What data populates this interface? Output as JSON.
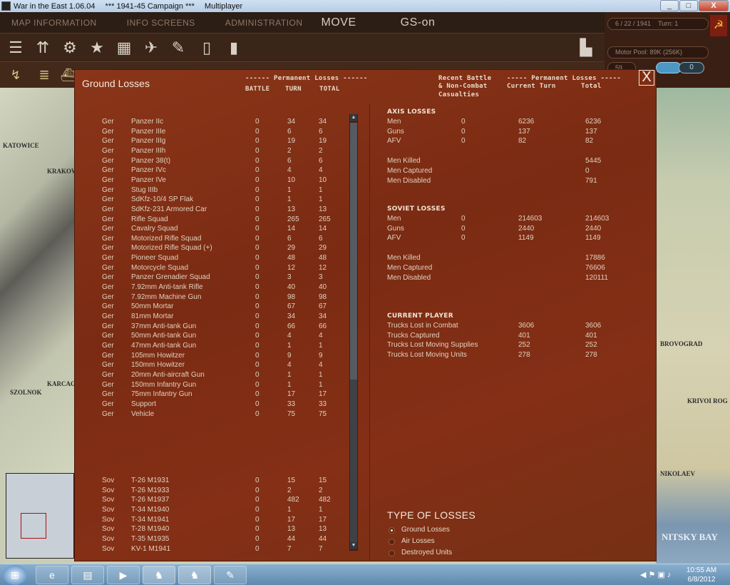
{
  "window": {
    "title": "War in the East 1.06.04",
    "campaign": "***    1941-45 Campaign    ***",
    "mode": "Multiplayer",
    "min_label": "_",
    "max_label": "□",
    "close_label": "X"
  },
  "menu": {
    "map_information": "MAP INFORMATION",
    "info_screens": "INFO SCREENS",
    "administration": "ADMINISTRATION",
    "move": "MOVE",
    "gs_on": "GS-on"
  },
  "status": {
    "date": "6 / 22 / 1941",
    "turn": "Turn: 1",
    "motor_pool": "Motor Pool: 89K (256K)",
    "value_box": "59",
    "pill_1": "",
    "pill_2": "0"
  },
  "map_labels": {
    "katowice": "KATOWICE",
    "krakow": "KRAKOW",
    "szolnok": "SZOLNOK",
    "karcag": "KARCAG",
    "krivoi_rog": "KRIVOI ROG",
    "nikolaev": "NIKOLAEV",
    "bovograd": "BROVOGRAD",
    "nitsky_bay": "NITSKY BAY"
  },
  "dialog": {
    "title": "Ground Losses",
    "left_group_header": "------ Permanent Losses ------",
    "col_battle": "BATTLE",
    "col_turn": "TURN",
    "col_total": "TOTAL",
    "recent_header_1": "Recent Battle",
    "recent_header_2": "& Non-Combat",
    "recent_header_3": "Casualties",
    "right_group_header": "----- Permanent Losses -----",
    "col_current_turn": "Current Turn",
    "col_total_right": "Total",
    "close_icon": "X"
  },
  "ger_rows": [
    {
      "side": "Ger",
      "unit": "Panzer IIc",
      "battle": "0",
      "turn": "34",
      "total": "34"
    },
    {
      "side": "Ger",
      "unit": "Panzer IIIe",
      "battle": "0",
      "turn": "6",
      "total": "6"
    },
    {
      "side": "Ger",
      "unit": "Panzer IIIg",
      "battle": "0",
      "turn": "19",
      "total": "19"
    },
    {
      "side": "Ger",
      "unit": "Panzer IIIh",
      "battle": "0",
      "turn": "2",
      "total": "2"
    },
    {
      "side": "Ger",
      "unit": "Panzer 38(t)",
      "battle": "0",
      "turn": "6",
      "total": "6"
    },
    {
      "side": "Ger",
      "unit": "Panzer IVc",
      "battle": "0",
      "turn": "4",
      "total": "4"
    },
    {
      "side": "Ger",
      "unit": "Panzer IVe",
      "battle": "0",
      "turn": "10",
      "total": "10"
    },
    {
      "side": "Ger",
      "unit": "Stug IIIb",
      "battle": "0",
      "turn": "1",
      "total": "1"
    },
    {
      "side": "Ger",
      "unit": "SdKfz-10/4 SP Flak",
      "battle": "0",
      "turn": "1",
      "total": "1"
    },
    {
      "side": "Ger",
      "unit": "SdKfz-231 Armored Car",
      "battle": "0",
      "turn": "13",
      "total": "13"
    },
    {
      "side": "Ger",
      "unit": "Rifle Squad",
      "battle": "0",
      "turn": "265",
      "total": "265"
    },
    {
      "side": "Ger",
      "unit": "Cavalry Squad",
      "battle": "0",
      "turn": "14",
      "total": "14"
    },
    {
      "side": "Ger",
      "unit": "Motorized Rifle Squad",
      "battle": "0",
      "turn": "6",
      "total": "6"
    },
    {
      "side": "Ger",
      "unit": "Motorized Rifle Squad (+)",
      "battle": "0",
      "turn": "29",
      "total": "29"
    },
    {
      "side": "Ger",
      "unit": "Pioneer Squad",
      "battle": "0",
      "turn": "48",
      "total": "48"
    },
    {
      "side": "Ger",
      "unit": "Motorcycle Squad",
      "battle": "0",
      "turn": "12",
      "total": "12"
    },
    {
      "side": "Ger",
      "unit": "Panzer Grenadier Squad",
      "battle": "0",
      "turn": "3",
      "total": "3"
    },
    {
      "side": "Ger",
      "unit": "7.92mm Anti-tank Rifle",
      "battle": "0",
      "turn": "40",
      "total": "40"
    },
    {
      "side": "Ger",
      "unit": "7.92mm Machine Gun",
      "battle": "0",
      "turn": "98",
      "total": "98"
    },
    {
      "side": "Ger",
      "unit": "50mm Mortar",
      "battle": "0",
      "turn": "67",
      "total": "67"
    },
    {
      "side": "Ger",
      "unit": "81mm Mortar",
      "battle": "0",
      "turn": "34",
      "total": "34"
    },
    {
      "side": "Ger",
      "unit": "37mm Anti-tank Gun",
      "battle": "0",
      "turn": "66",
      "total": "66"
    },
    {
      "side": "Ger",
      "unit": "50mm Anti-tank Gun",
      "battle": "0",
      "turn": "4",
      "total": "4"
    },
    {
      "side": "Ger",
      "unit": "47mm Anti-tank Gun",
      "battle": "0",
      "turn": "1",
      "total": "1"
    },
    {
      "side": "Ger",
      "unit": "105mm Howitzer",
      "battle": "0",
      "turn": "9",
      "total": "9"
    },
    {
      "side": "Ger",
      "unit": "150mm Howitzer",
      "battle": "0",
      "turn": "4",
      "total": "4"
    },
    {
      "side": "Ger",
      "unit": "20mm Anti-aircraft Gun",
      "battle": "0",
      "turn": "1",
      "total": "1"
    },
    {
      "side": "Ger",
      "unit": "150mm Infantry Gun",
      "battle": "0",
      "turn": "1",
      "total": "1"
    },
    {
      "side": "Ger",
      "unit": "75mm Infantry Gun",
      "battle": "0",
      "turn": "17",
      "total": "17"
    },
    {
      "side": "Ger",
      "unit": "Support",
      "battle": "0",
      "turn": "33",
      "total": "33"
    },
    {
      "side": "Ger",
      "unit": "Vehicle",
      "battle": "0",
      "turn": "75",
      "total": "75"
    }
  ],
  "sov_rows": [
    {
      "side": "Sov",
      "unit": "T-26 M1931",
      "battle": "0",
      "turn": "15",
      "total": "15"
    },
    {
      "side": "Sov",
      "unit": "T-26 M1933",
      "battle": "0",
      "turn": "2",
      "total": "2"
    },
    {
      "side": "Sov",
      "unit": "T-26 M1937",
      "battle": "0",
      "turn": "482",
      "total": "482"
    },
    {
      "side": "Sov",
      "unit": "T-34 M1940",
      "battle": "0",
      "turn": "1",
      "total": "1"
    },
    {
      "side": "Sov",
      "unit": "T-34 M1941",
      "battle": "0",
      "turn": "17",
      "total": "17"
    },
    {
      "side": "Sov",
      "unit": "T-28 M1940",
      "battle": "0",
      "turn": "13",
      "total": "13"
    },
    {
      "side": "Sov",
      "unit": "T-35 M1935",
      "battle": "0",
      "turn": "44",
      "total": "44"
    },
    {
      "side": "Sov",
      "unit": "KV-1 M1941",
      "battle": "0",
      "turn": "7",
      "total": "7"
    }
  ],
  "axis": {
    "heading": "AXIS LOSSES",
    "rows": [
      {
        "label": "Men",
        "recent": "0",
        "turn": "6236",
        "total": "6236"
      },
      {
        "label": "Guns",
        "recent": "0",
        "turn": "137",
        "total": "137"
      },
      {
        "label": "AFV",
        "recent": "0",
        "turn": "82",
        "total": "82"
      }
    ],
    "killed": {
      "label": "Men Killed",
      "total": "5445"
    },
    "captured": {
      "label": "Men Captured",
      "total": "0"
    },
    "disabled": {
      "label": "Men Disabled",
      "total": "791"
    }
  },
  "soviet": {
    "heading": "SOVIET LOSSES",
    "rows": [
      {
        "label": "Men",
        "recent": "0",
        "turn": "214603",
        "total": "214603"
      },
      {
        "label": "Guns",
        "recent": "0",
        "turn": "2440",
        "total": "2440"
      },
      {
        "label": "AFV",
        "recent": "0",
        "turn": "1149",
        "total": "1149"
      }
    ],
    "killed": {
      "label": "Men Killed",
      "total": "17886"
    },
    "captured": {
      "label": "Men Captured",
      "total": "76606"
    },
    "disabled": {
      "label": "Men Disabled",
      "total": "120111"
    }
  },
  "current_player": {
    "heading": "CURRENT PLAYER",
    "rows": [
      {
        "label": "Trucks Lost in Combat",
        "turn": "3606",
        "total": "3606"
      },
      {
        "label": "Trucks Captured",
        "turn": "401",
        "total": "401"
      },
      {
        "label": "Trucks Lost Moving Supplies",
        "turn": "252",
        "total": "252"
      },
      {
        "label": "Trucks Lost Moving Units",
        "turn": "278",
        "total": "278"
      }
    ]
  },
  "type_of_losses": {
    "heading": "TYPE OF LOSSES",
    "options": [
      {
        "label": "Ground Losses",
        "selected": true
      },
      {
        "label": "Air Losses",
        "selected": false
      },
      {
        "label": "Destroyed Units",
        "selected": false
      }
    ]
  },
  "taskbar": {
    "time": "10:55 AM",
    "date": "6/8/2012"
  },
  "colors": {
    "dialog_bg": "#7f2d14",
    "menubar_bg": "#2c1d15",
    "text": "#e0d2bf"
  },
  "icons": {
    "tools_row1": [
      "layers-icon",
      "units-icon",
      "gear-icon",
      "star-icon",
      "weather-icon",
      "aircraft-icon",
      "supply-icon",
      "fuel-icon",
      "document-icon"
    ],
    "tools_row2": [
      "move-icon",
      "rail-icon",
      "ship-icon"
    ]
  }
}
